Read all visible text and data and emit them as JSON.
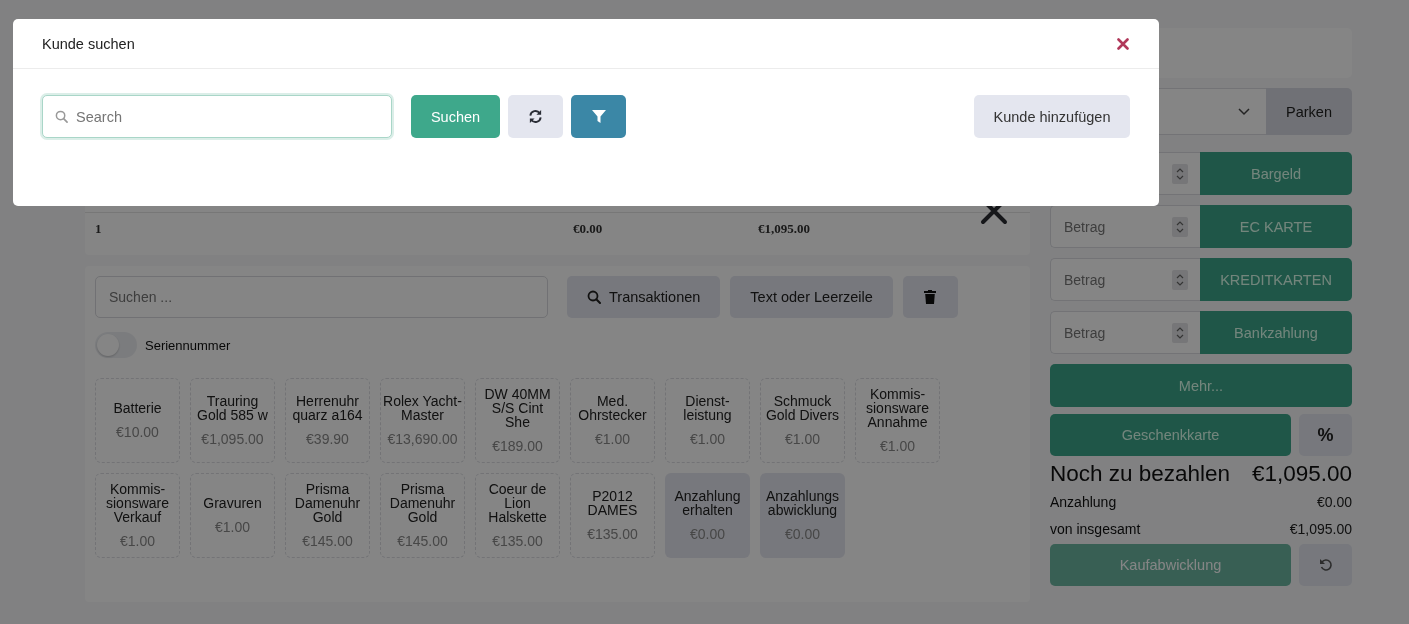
{
  "modal": {
    "title": "Kunde suchen",
    "search": {
      "placeholder": "Search"
    },
    "buttons": [
      {
        "kind": "search",
        "label": "Suchen"
      },
      {
        "kind": "refresh"
      },
      {
        "kind": "filter"
      }
    ],
    "add_button": "Kunde hinzufügen"
  },
  "summary_row": {
    "cells": [
      "1",
      "€0.00",
      "€1,095.00"
    ]
  },
  "article_search": {
    "placeholder": "Suchen ..."
  },
  "toolbar": [
    {
      "kind": "transactions",
      "label": "Transaktionen"
    },
    {
      "kind": "text",
      "label": "Text oder Leerzeile"
    },
    {
      "kind": "delete"
    }
  ],
  "serial_toggle": {
    "label": "Seriennummer",
    "on": false
  },
  "products": [
    {
      "name": "Batterie",
      "price": "€10.00",
      "kind": "product"
    },
    {
      "name": "Trauring Gold 585 w",
      "price": "€1,095.00",
      "kind": "product"
    },
    {
      "name": "Herrenuhr quarz a164",
      "price": "€39.90",
      "kind": "product"
    },
    {
      "name": "Rolex Yacht-Master",
      "price": "€13,690.00",
      "kind": "product"
    },
    {
      "name": "DW 40MM S/S Cint She",
      "price": "€189.00",
      "kind": "product"
    },
    {
      "name": "Med. Ohrstecker",
      "price": "€1.00",
      "kind": "product"
    },
    {
      "name": "Dienst-leistung",
      "price": "€1.00",
      "kind": "product"
    },
    {
      "name": "Schmuck Gold Divers",
      "price": "€1.00",
      "kind": "product"
    },
    {
      "name": "Kommis-sionsware Annahme",
      "price": "€1.00",
      "kind": "product"
    },
    {
      "name": "Kommis-sionsware Verkauf",
      "price": "€1.00",
      "kind": "product"
    },
    {
      "name": "Gravuren",
      "price": "€1.00",
      "kind": "product"
    },
    {
      "name": "Prisma Damenuhr Gold",
      "price": "€145.00",
      "kind": "product"
    },
    {
      "name": "Prisma Damenuhr Gold",
      "price": "€145.00",
      "kind": "product"
    },
    {
      "name": "Coeur de Lion Halskette",
      "price": "€135.00",
      "kind": "product"
    },
    {
      "name": "P2012 DAMES",
      "price": "€135.00",
      "kind": "product"
    },
    {
      "name": "Anzahlung erhalten",
      "price": "€0.00",
      "kind": "deposit"
    },
    {
      "name": "Anzahlungs abwicklung",
      "price": "€0.00",
      "kind": "deposit"
    }
  ],
  "park_button": "Parken",
  "payments": [
    {
      "label": "Bargeld"
    },
    {
      "placeholder": "Betrag",
      "label": "EC KARTE"
    },
    {
      "placeholder": "Betrag",
      "label": "KREDITKARTEN"
    },
    {
      "placeholder": "Betrag",
      "label": "Bankzahlung"
    }
  ],
  "more_button": "Mehr...",
  "gift_card_button": "Geschenkkarte",
  "percent_button": "%",
  "due": {
    "label": "Noch zu bezahlen",
    "value": "€1,095.00"
  },
  "totals": [
    {
      "label": "Anzahlung",
      "value": "€0.00"
    },
    {
      "label": "von insgesamt",
      "value": "€1,095.00"
    }
  ],
  "checkout_button": {
    "label": "Kaufabwicklung",
    "disabled": true
  }
}
